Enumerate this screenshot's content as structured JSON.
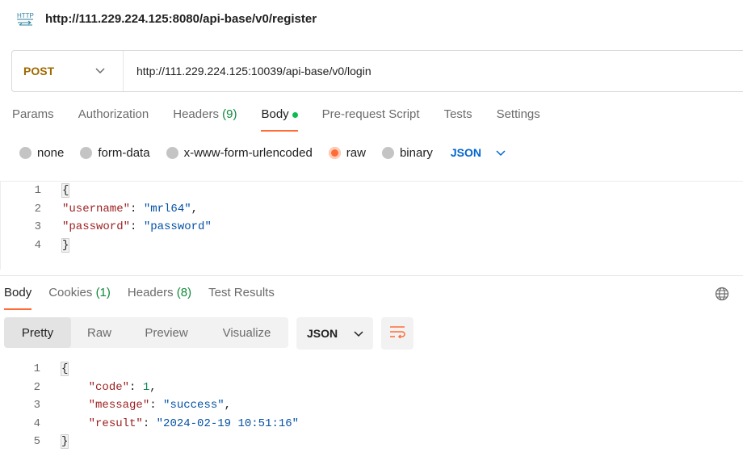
{
  "request": {
    "title": "http://111.229.224.125:8080/api-base/v0/register",
    "method": "POST",
    "url": "http://111.229.224.125:10039/api-base/v0/login"
  },
  "request_tabs": [
    {
      "label": "Params"
    },
    {
      "label": "Authorization"
    },
    {
      "label": "Headers ",
      "count": "(9)"
    },
    {
      "label": "Body"
    },
    {
      "label": "Pre-request Script"
    },
    {
      "label": "Tests"
    },
    {
      "label": "Settings"
    }
  ],
  "body_types": [
    "none",
    "form-data",
    "x-www-form-urlencoded",
    "raw",
    "binary"
  ],
  "body_type_selected": "raw",
  "body_language": "JSON",
  "request_body": {
    "line_numbers": [
      "1",
      "2",
      "3",
      "4"
    ],
    "open_brace": "{",
    "close_brace": "}",
    "username_key": "\"username\"",
    "username_value": "\"mrl64\"",
    "password_key": "\"password\"",
    "password_value": "\"password\""
  },
  "response_tabs": [
    {
      "label": "Body"
    },
    {
      "label": "Cookies ",
      "count": "(1)"
    },
    {
      "label": "Headers ",
      "count": "(8)"
    },
    {
      "label": "Test Results"
    }
  ],
  "response_views": [
    "Pretty",
    "Raw",
    "Preview",
    "Visualize"
  ],
  "response_format": "JSON",
  "response_body": {
    "line_numbers": [
      "1",
      "2",
      "3",
      "4",
      "5"
    ],
    "open_brace": "{",
    "close_brace": "}",
    "code_key": "\"code\"",
    "code_value": "1",
    "message_key": "\"message\"",
    "message_value": "\"success\"",
    "result_key": "\"result\"",
    "result_value": "\"2024-02-19 10:51:16\""
  },
  "colors": {
    "accent": "#ff6c37",
    "method": "#a06800",
    "link_blue": "#0265d2",
    "count_green": "#0f8a3a"
  },
  "icons": {
    "request": "http-icon",
    "globe": "globe-icon",
    "wrap": "wrap-lines-icon"
  }
}
